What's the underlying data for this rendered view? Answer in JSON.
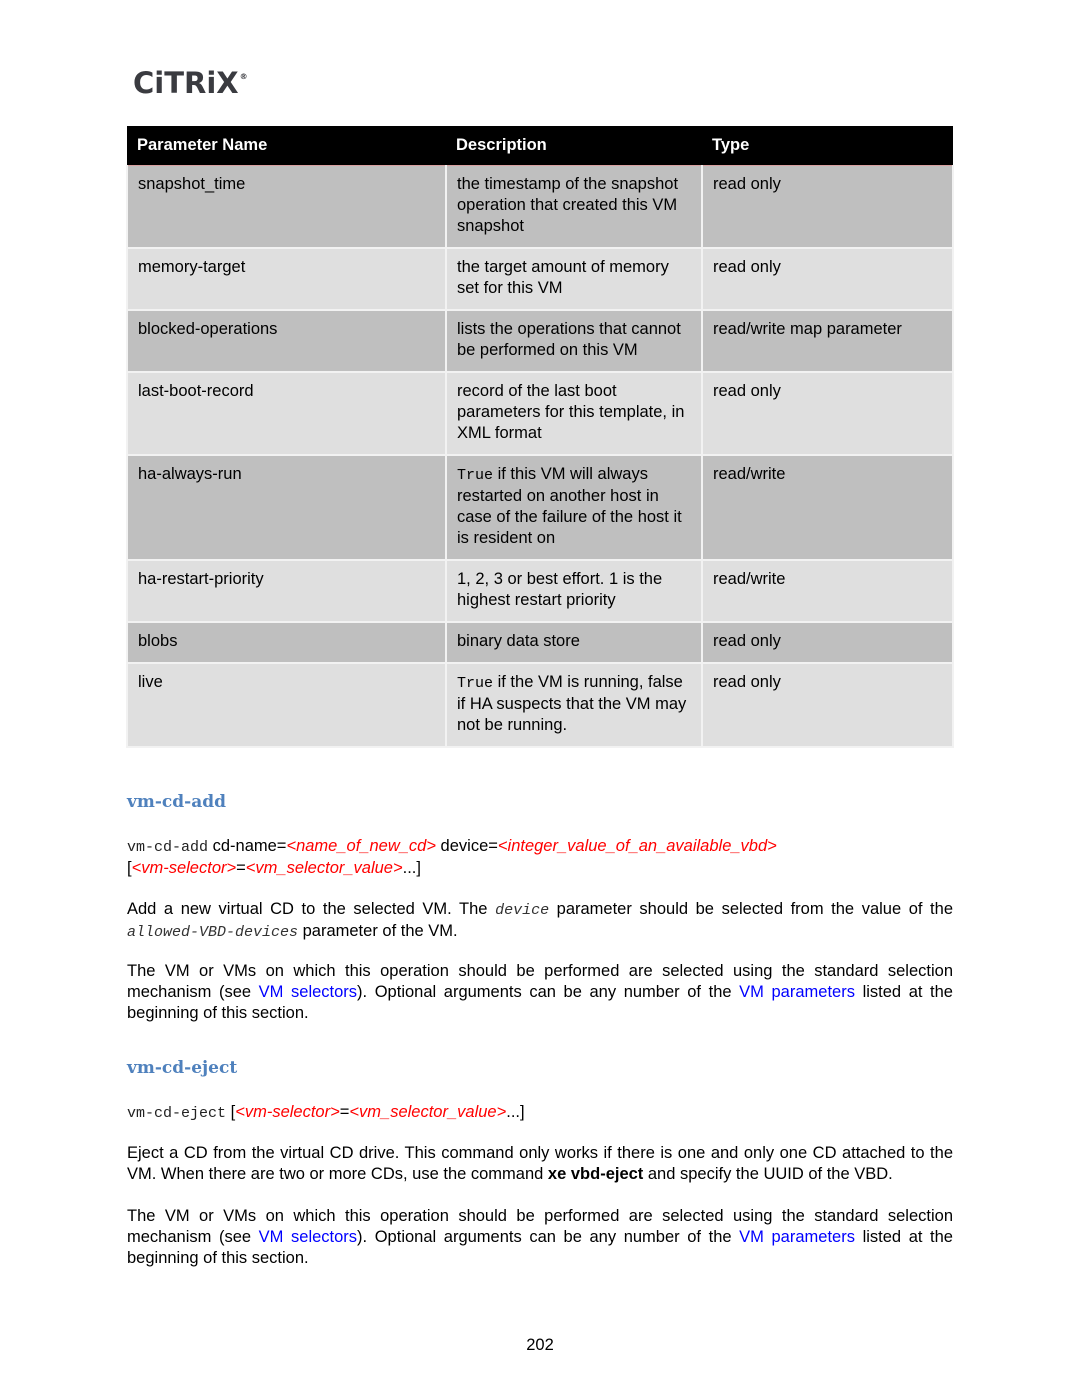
{
  "header": {
    "logo_text": "CiTRiX",
    "logo_mark": "®"
  },
  "table": {
    "columns": [
      "Parameter Name",
      "Description",
      "Type"
    ],
    "rows": [
      {
        "name": "snapshot_time",
        "desc_code": "",
        "description": "the timestamp of the snapshot operation that created this VM snapshot",
        "type": "read only",
        "shade": "dark"
      },
      {
        "name": "memory-target",
        "desc_code": "",
        "description": "the target amount of memory set for this VM",
        "type": "read only",
        "shade": "light"
      },
      {
        "name": "blocked-operations",
        "desc_code": "",
        "description": "lists the operations that cannot be performed on this VM",
        "type": "read/write map parameter",
        "shade": "dark"
      },
      {
        "name": "last-boot-record",
        "desc_code": "",
        "description": "record of the last boot parameters for this template, in XML format",
        "type": "read only",
        "shade": "light"
      },
      {
        "name": "ha-always-run",
        "desc_code": "True",
        "description": " if this VM will always restarted on another host in case of the failure of the host it is resident on",
        "type": "read/write",
        "shade": "dark"
      },
      {
        "name": "ha-restart-priority",
        "desc_code": "",
        "description": "1, 2, 3 or best effort. 1 is the highest restart priority",
        "type": "read/write",
        "shade": "light"
      },
      {
        "name": "blobs",
        "desc_code": "",
        "description": "binary data store",
        "type": "read only",
        "shade": "dark"
      },
      {
        "name": "live",
        "desc_code": "True",
        "description": " if the VM is running, false if HA suspects that the VM may not be running.",
        "type": "read only",
        "shade": "light"
      }
    ]
  },
  "sections": {
    "cd_add": {
      "title": "vm-cd-add",
      "syntax": {
        "cmd": "vm-cd-add",
        "p1": " cd-name=",
        "v1": "<name_of_new_cd>",
        "p2": " device=",
        "v2": "<integer_value_of_an_available_vbd>",
        "open": "[",
        "sel": "<vm-selector>",
        "eq": "=",
        "selval": "<vm_selector_value>",
        "close": "...]"
      },
      "para1": {
        "t1": "Add a new virtual CD to the selected VM. The ",
        "code1": "device",
        "t2": " parameter should be selected from the value of the ",
        "code2": "allowed-VBD-devices",
        "t3": " parameter of the VM."
      },
      "para2": {
        "t1": "The VM or VMs on which this operation should be performed are selected using the standard selection mechanism (see ",
        "link1": "VM selectors",
        "t2": "). Optional arguments can be any number of the ",
        "link2": "VM parameters",
        "t3": " listed at the beginning of this section."
      }
    },
    "cd_eject": {
      "title": "vm-cd-eject",
      "syntax": {
        "cmd": "vm-cd-eject",
        "open": " [",
        "sel": "<vm-selector>",
        "eq": "=",
        "selval": "<vm_selector_value>",
        "close": "...]"
      },
      "para1": {
        "t1": "Eject a CD from the virtual CD drive. This command only works if there is one and only one CD attached to the VM. When there are two or more CDs, use the command ",
        "bold": "xe vbd-eject",
        "t2": " and specify the UUID of the VBD."
      },
      "para2": {
        "t1": "The VM or VMs on which this operation should be performed are selected using the standard selection mechanism (see ",
        "link1": "VM selectors",
        "t2": "). Optional arguments can be any number of the ",
        "link2": "VM parameters",
        "t3": " listed at the beginning of this section."
      }
    }
  },
  "footer": {
    "page_number": "202"
  },
  "colors": {
    "heading": "#4f81bd",
    "placeholder_red": "#ff0000",
    "link_blue": "#0000ff",
    "row_dark": "#bfbfbf",
    "row_light": "#dfdfdf",
    "header_bg": "#000000"
  }
}
